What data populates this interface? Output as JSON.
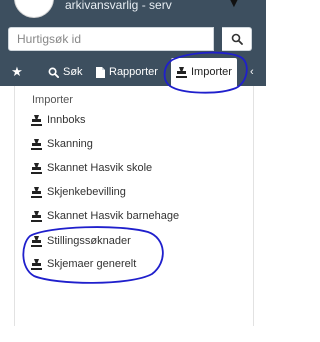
{
  "header": {
    "user_label": "arkivansvarlig - serv"
  },
  "search": {
    "placeholder": "Hurtigsøk id",
    "search_icon": "search-icon"
  },
  "tabs": [
    {
      "id": "favorites",
      "icon": "star-icon",
      "label": ""
    },
    {
      "id": "sok",
      "icon": "search-icon",
      "label": "Søk"
    },
    {
      "id": "rapporter",
      "icon": "file-icon",
      "label": "Rapporter"
    },
    {
      "id": "importer",
      "icon": "import-stamp-icon",
      "label": "Importer",
      "active": true
    },
    {
      "id": "more",
      "icon": "more-icon",
      "label": ""
    }
  ],
  "list": {
    "header": "Importer",
    "items": [
      {
        "label": "Innboks",
        "icon": "import-stamp-icon"
      },
      {
        "label": "Skanning",
        "icon": "import-stamp-icon"
      },
      {
        "label": "Skannet Hasvik skole",
        "icon": "import-stamp-icon"
      },
      {
        "label": "Skjenkebevilling",
        "icon": "import-stamp-icon"
      },
      {
        "label": "Skannet Hasvik barnehage",
        "icon": "import-stamp-icon"
      },
      {
        "label": "Stillingssøknader",
        "icon": "import-stamp-icon"
      },
      {
        "label": "Skjemaer generelt",
        "icon": "import-stamp-icon"
      }
    ]
  },
  "colors": {
    "header_bg": "#3d4f5f",
    "annotation": "#1f1fcc"
  }
}
